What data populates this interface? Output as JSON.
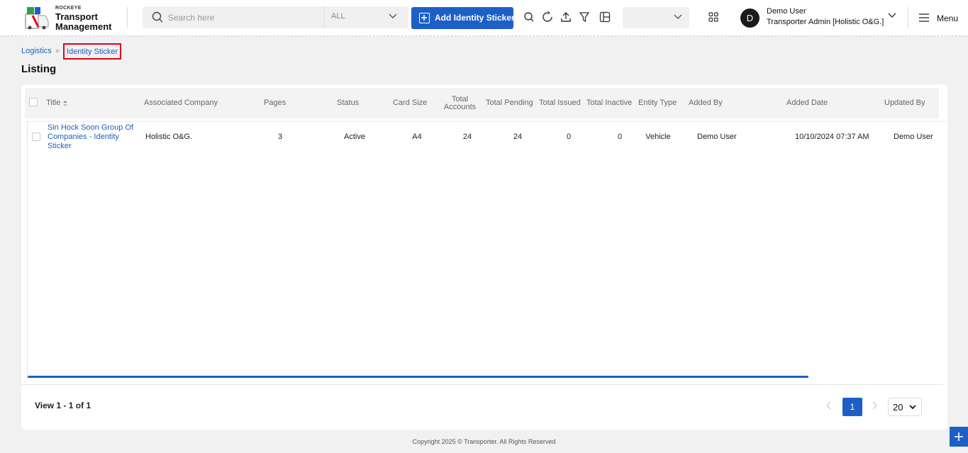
{
  "brand": {
    "company": "ROCKEYE",
    "app_name": "Transport Management"
  },
  "search": {
    "placeholder": "Search here",
    "scope": "ALL"
  },
  "toolbar": {
    "add_label": "Add Identity Sticker",
    "icons": [
      "search-icon",
      "refresh-icon",
      "upload-icon",
      "filter-icon",
      "columns-icon",
      "apps-grid-icon"
    ]
  },
  "user": {
    "initial": "D",
    "name": "Demo User",
    "role": "Transporter Admin [Holistic O&G.]"
  },
  "menu": {
    "label": "Menu"
  },
  "breadcrumb": {
    "parent": "Logistics",
    "current": "Identity Sticker"
  },
  "page": {
    "title": "Listing"
  },
  "table": {
    "columns": {
      "title": "Title",
      "associated_company": "Associated Company",
      "pages": "Pages",
      "status": "Status",
      "card_size": "Card Size",
      "total_accounts": "Total Accounts",
      "total_pending": "Total Pending",
      "total_issued": "Total Issued",
      "total_inactive": "Total Inactive",
      "entity_type": "Entity Type",
      "added_by": "Added By",
      "added_date": "Added Date",
      "updated_by": "Updated By"
    },
    "rows": [
      {
        "title": "Sin Hock Soon Group Of Companies - Identity Sticker",
        "associated_company": "Holistic O&G.",
        "pages": "3",
        "status": "Active",
        "card_size": "A4",
        "total_accounts": "24",
        "total_pending": "24",
        "total_issued": "0",
        "total_inactive": "0",
        "entity_type": "Vehicle",
        "added_by": "Demo User",
        "added_date": "10/10/2024 07:37 AM",
        "updated_by": "Demo User"
      }
    ]
  },
  "pagination": {
    "summary": "View 1 - 1 of 1",
    "current_page": "1",
    "page_size": "20"
  },
  "footer": {
    "copyright": "Copyright 2025 © Transporter. All Rights Reserved"
  },
  "colors": {
    "accent": "#1c5fc7",
    "highlight": "#e4001b"
  }
}
